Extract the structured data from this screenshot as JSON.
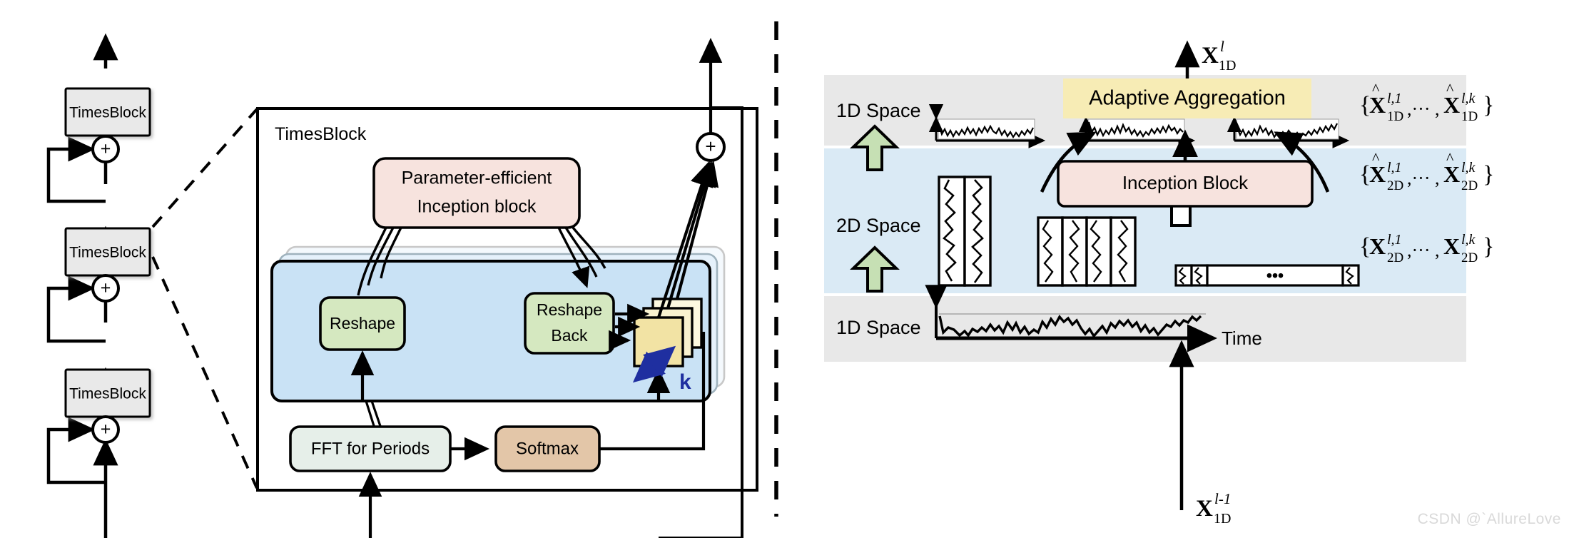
{
  "meta": {
    "watermark": "CSDN @`AllureLove",
    "colors": {
      "timesblock_fill": "#e9e9e9",
      "pink_fill": "#f7e3de",
      "green_fill": "#d5e8c0",
      "blue_fill": "#c9e2f5",
      "tan_fill": "#e3c6a8",
      "mint_fill": "#e6efe9",
      "yellow_fill": "#f7ecb5",
      "yellow_front": "#f2e3a4",
      "band_gray": "#e8e8e8",
      "band_blue": "#daeaf5",
      "arrow_green": "#c6e0b4",
      "accent_blue": "#1f2fa0",
      "stroke": "#000000"
    }
  },
  "left_panel": {
    "blocks": [
      {
        "label": "TimesBlock"
      },
      {
        "label": "TimesBlock"
      },
      {
        "label": "TimesBlock"
      }
    ],
    "adders": [
      {
        "symbol": "+"
      },
      {
        "symbol": "+"
      },
      {
        "symbol": "+"
      }
    ]
  },
  "middle_panel": {
    "title": "TimesBlock",
    "inception": {
      "line1": "Parameter-efficient",
      "line2": "Inception block"
    },
    "reshape": {
      "label": "Reshape"
    },
    "reshape_back": {
      "line1": "Reshape",
      "line2": "Back"
    },
    "fft": {
      "label": "FFT for Periods"
    },
    "softmax": {
      "label": "Softmax"
    },
    "k_label": "k",
    "adder": {
      "symbol": "+"
    }
  },
  "right_panel": {
    "bands": [
      {
        "name": "1D Space",
        "label": "1D Space"
      },
      {
        "name": "2D Space",
        "label": "2D Space"
      },
      {
        "name": "1D Space",
        "label": "1D Space"
      }
    ],
    "adaptive_aggregation": {
      "label": "Adaptive Aggregation"
    },
    "inception_block": {
      "label": "Inception Block"
    },
    "time_axis_label": "Time",
    "annotations": {
      "output": {
        "base": "X",
        "sup": "l",
        "sub": "1D"
      },
      "input": {
        "base": "X",
        "sup": "l-1",
        "sub": "1D"
      },
      "set_1d_hat": {
        "open": "{",
        "b1": "X",
        "s1": "l,1",
        "d1": "1D",
        "dots": ",··· ,",
        "b2": "X",
        "s2": "l,k",
        "d2": "1D",
        "close": "}",
        "hat": true
      },
      "set_2d_hat": {
        "open": "{",
        "b1": "X",
        "s1": "l,1",
        "d1": "2D",
        "dots": ",··· ,",
        "b2": "X",
        "s2": "l,k",
        "d2": "2D",
        "close": "}",
        "hat": true
      },
      "set_2d": {
        "open": "{",
        "b1": "X",
        "s1": "l,1",
        "d1": "2D",
        "dots": ",··· ,",
        "b2": "X",
        "s2": "l,k",
        "d2": "2D",
        "close": "}",
        "hat": false
      }
    },
    "ellipsis": "•••"
  }
}
